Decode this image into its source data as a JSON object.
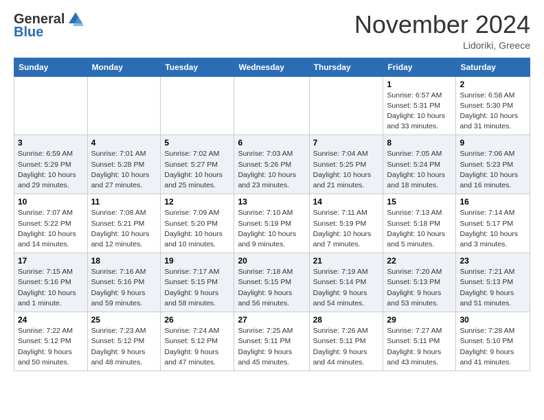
{
  "header": {
    "logo_general": "General",
    "logo_blue": "Blue",
    "month_title": "November 2024",
    "location": "Lidoriki, Greece"
  },
  "weekdays": [
    "Sunday",
    "Monday",
    "Tuesday",
    "Wednesday",
    "Thursday",
    "Friday",
    "Saturday"
  ],
  "rows": [
    [
      {
        "day": "",
        "info": ""
      },
      {
        "day": "",
        "info": ""
      },
      {
        "day": "",
        "info": ""
      },
      {
        "day": "",
        "info": ""
      },
      {
        "day": "",
        "info": ""
      },
      {
        "day": "1",
        "info": "Sunrise: 6:57 AM\nSunset: 5:31 PM\nDaylight: 10 hours\nand 33 minutes."
      },
      {
        "day": "2",
        "info": "Sunrise: 6:58 AM\nSunset: 5:30 PM\nDaylight: 10 hours\nand 31 minutes."
      }
    ],
    [
      {
        "day": "3",
        "info": "Sunrise: 6:59 AM\nSunset: 5:29 PM\nDaylight: 10 hours\nand 29 minutes."
      },
      {
        "day": "4",
        "info": "Sunrise: 7:01 AM\nSunset: 5:28 PM\nDaylight: 10 hours\nand 27 minutes."
      },
      {
        "day": "5",
        "info": "Sunrise: 7:02 AM\nSunset: 5:27 PM\nDaylight: 10 hours\nand 25 minutes."
      },
      {
        "day": "6",
        "info": "Sunrise: 7:03 AM\nSunset: 5:26 PM\nDaylight: 10 hours\nand 23 minutes."
      },
      {
        "day": "7",
        "info": "Sunrise: 7:04 AM\nSunset: 5:25 PM\nDaylight: 10 hours\nand 21 minutes."
      },
      {
        "day": "8",
        "info": "Sunrise: 7:05 AM\nSunset: 5:24 PM\nDaylight: 10 hours\nand 18 minutes."
      },
      {
        "day": "9",
        "info": "Sunrise: 7:06 AM\nSunset: 5:23 PM\nDaylight: 10 hours\nand 16 minutes."
      }
    ],
    [
      {
        "day": "10",
        "info": "Sunrise: 7:07 AM\nSunset: 5:22 PM\nDaylight: 10 hours\nand 14 minutes."
      },
      {
        "day": "11",
        "info": "Sunrise: 7:08 AM\nSunset: 5:21 PM\nDaylight: 10 hours\nand 12 minutes."
      },
      {
        "day": "12",
        "info": "Sunrise: 7:09 AM\nSunset: 5:20 PM\nDaylight: 10 hours\nand 10 minutes."
      },
      {
        "day": "13",
        "info": "Sunrise: 7:10 AM\nSunset: 5:19 PM\nDaylight: 10 hours\nand 9 minutes."
      },
      {
        "day": "14",
        "info": "Sunrise: 7:11 AM\nSunset: 5:19 PM\nDaylight: 10 hours\nand 7 minutes."
      },
      {
        "day": "15",
        "info": "Sunrise: 7:13 AM\nSunset: 5:18 PM\nDaylight: 10 hours\nand 5 minutes."
      },
      {
        "day": "16",
        "info": "Sunrise: 7:14 AM\nSunset: 5:17 PM\nDaylight: 10 hours\nand 3 minutes."
      }
    ],
    [
      {
        "day": "17",
        "info": "Sunrise: 7:15 AM\nSunset: 5:16 PM\nDaylight: 10 hours\nand 1 minute."
      },
      {
        "day": "18",
        "info": "Sunrise: 7:16 AM\nSunset: 5:16 PM\nDaylight: 9 hours\nand 59 minutes."
      },
      {
        "day": "19",
        "info": "Sunrise: 7:17 AM\nSunset: 5:15 PM\nDaylight: 9 hours\nand 58 minutes."
      },
      {
        "day": "20",
        "info": "Sunrise: 7:18 AM\nSunset: 5:15 PM\nDaylight: 9 hours\nand 56 minutes."
      },
      {
        "day": "21",
        "info": "Sunrise: 7:19 AM\nSunset: 5:14 PM\nDaylight: 9 hours\nand 54 minutes."
      },
      {
        "day": "22",
        "info": "Sunrise: 7:20 AM\nSunset: 5:13 PM\nDaylight: 9 hours\nand 53 minutes."
      },
      {
        "day": "23",
        "info": "Sunrise: 7:21 AM\nSunset: 5:13 PM\nDaylight: 9 hours\nand 51 minutes."
      }
    ],
    [
      {
        "day": "24",
        "info": "Sunrise: 7:22 AM\nSunset: 5:12 PM\nDaylight: 9 hours\nand 50 minutes."
      },
      {
        "day": "25",
        "info": "Sunrise: 7:23 AM\nSunset: 5:12 PM\nDaylight: 9 hours\nand 48 minutes."
      },
      {
        "day": "26",
        "info": "Sunrise: 7:24 AM\nSunset: 5:12 PM\nDaylight: 9 hours\nand 47 minutes."
      },
      {
        "day": "27",
        "info": "Sunrise: 7:25 AM\nSunset: 5:11 PM\nDaylight: 9 hours\nand 45 minutes."
      },
      {
        "day": "28",
        "info": "Sunrise: 7:26 AM\nSunset: 5:11 PM\nDaylight: 9 hours\nand 44 minutes."
      },
      {
        "day": "29",
        "info": "Sunrise: 7:27 AM\nSunset: 5:11 PM\nDaylight: 9 hours\nand 43 minutes."
      },
      {
        "day": "30",
        "info": "Sunrise: 7:28 AM\nSunset: 5:10 PM\nDaylight: 9 hours\nand 41 minutes."
      }
    ]
  ]
}
